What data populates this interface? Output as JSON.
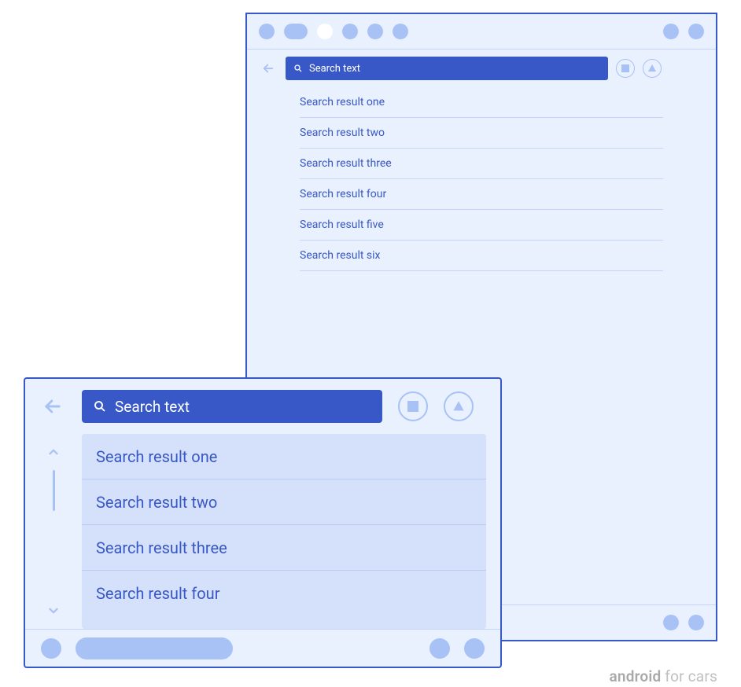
{
  "footer": {
    "brand_bold": "android",
    "brand_rest": " for cars"
  },
  "large": {
    "back_label": "Back",
    "search_placeholder": "Search text",
    "action_square_label": "Stop",
    "action_triangle_label": "Play",
    "results": [
      "Search result one",
      "Search result two",
      "Search result three",
      "Search result four",
      "Search result five",
      "Search result six"
    ]
  },
  "small": {
    "back_label": "Back",
    "search_placeholder": "Search text",
    "action_square_label": "Stop",
    "action_triangle_label": "Play",
    "scroller": {
      "up_label": "Scroll up",
      "down_label": "Scroll down"
    },
    "results": [
      "Search result one",
      "Search result two",
      "Search result three",
      "Search result four"
    ]
  }
}
